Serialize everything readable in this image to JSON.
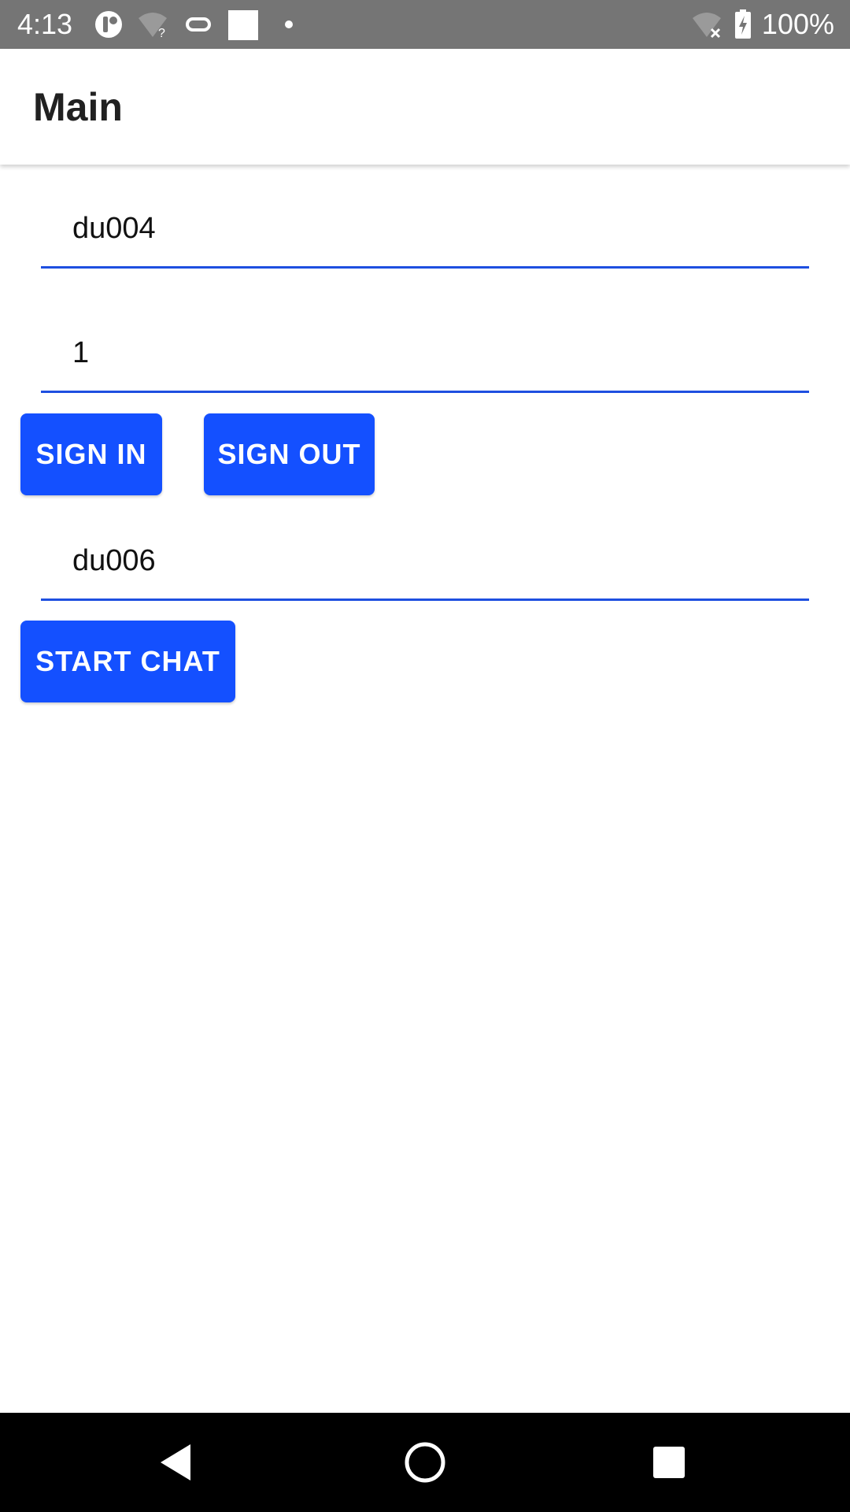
{
  "status_bar": {
    "time": "4:13",
    "battery_text": "100%",
    "icons": [
      "app-notification-icon",
      "wifi-question-icon",
      "pill-icon",
      "square-icon",
      "dot-icon",
      "wifi-off-icon",
      "battery-charging-icon"
    ]
  },
  "app_bar": {
    "title": "Main"
  },
  "form": {
    "username_value": "du004",
    "password_value": "1",
    "sign_in_label": "SIGN IN",
    "sign_out_label": "SIGN OUT",
    "chat_target_value": "du006",
    "start_chat_label": "START CHAT"
  },
  "nav_bar": {
    "icons": [
      "back-icon",
      "home-icon",
      "recents-icon"
    ]
  },
  "colors": {
    "accent": "#1450ff",
    "underline": "#1e4fe0",
    "status_bar": "#757575"
  }
}
